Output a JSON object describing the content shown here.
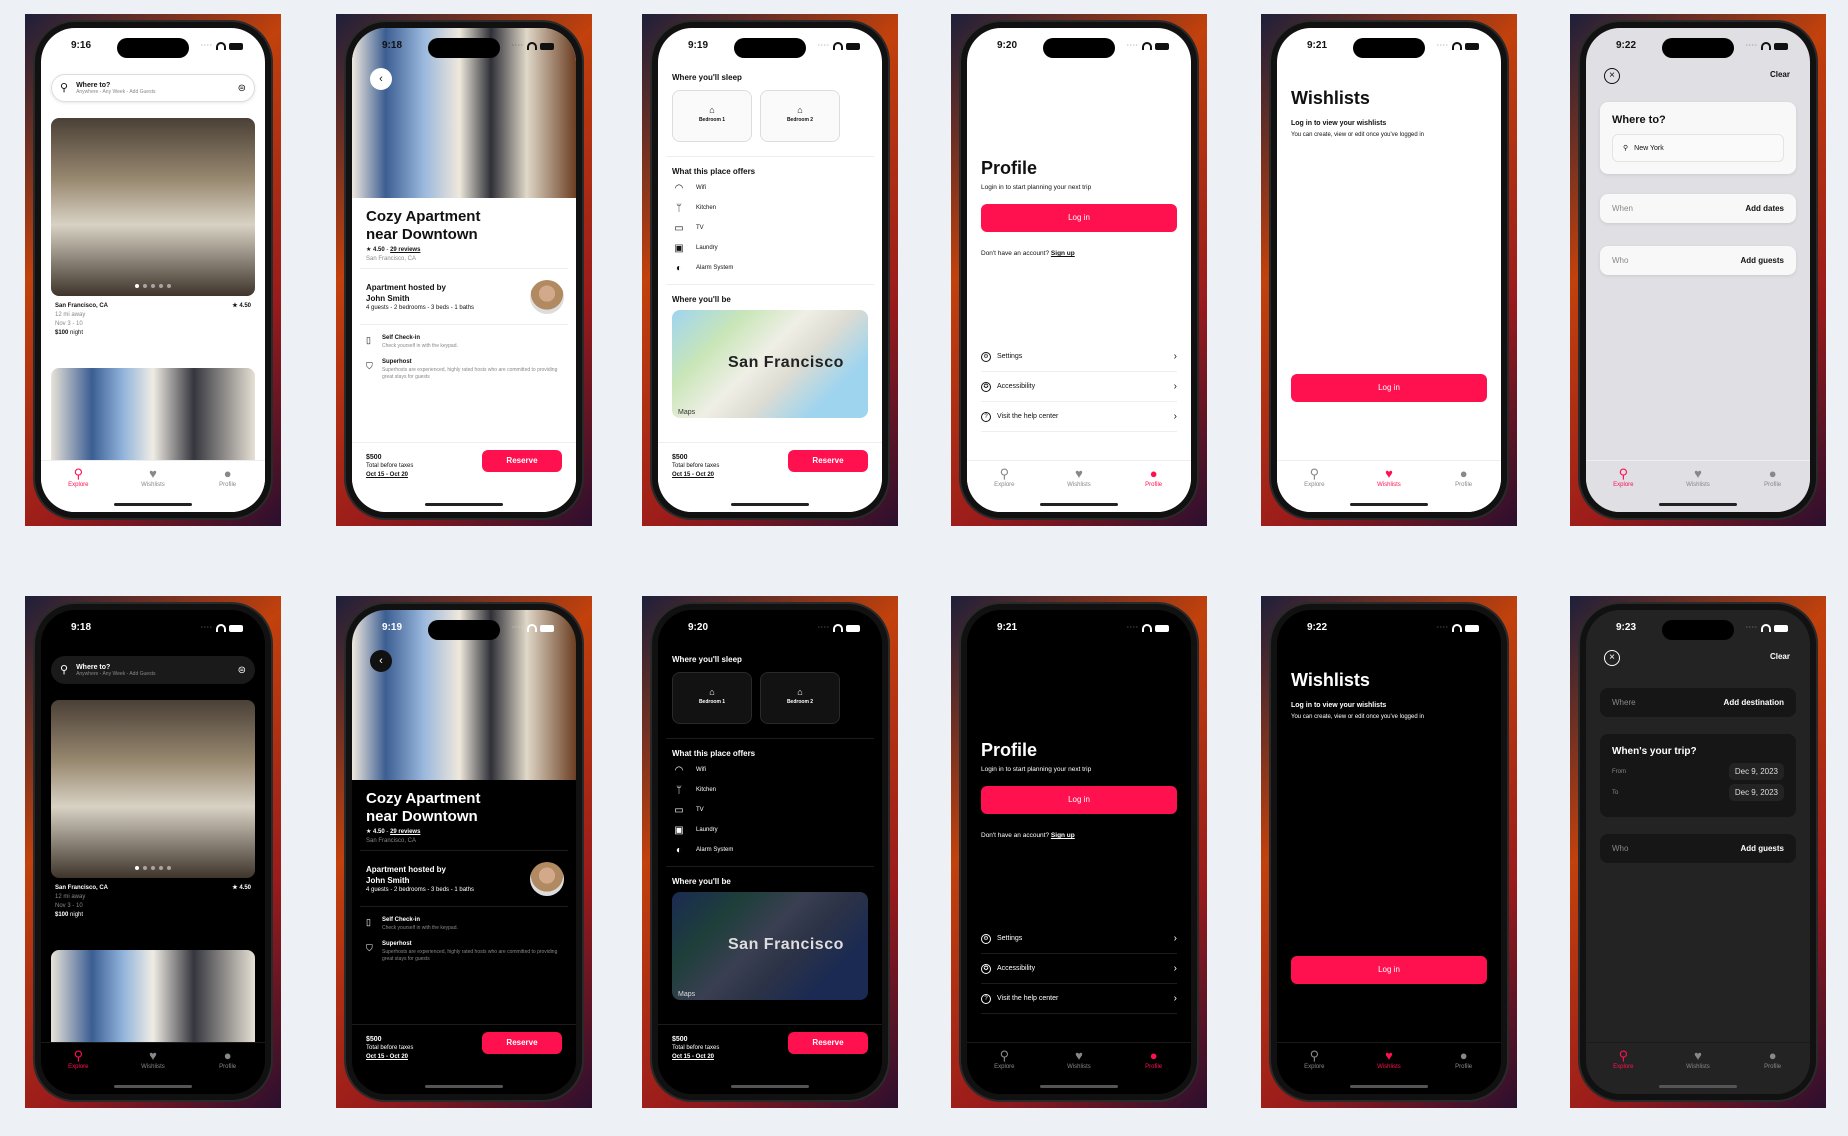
{
  "colors": {
    "accent": "#ff1150",
    "light_bg": "#ffffff",
    "dark_bg": "#000000",
    "page_bg": "#edf1f6"
  },
  "tabs": [
    "Explore",
    "Wishlists",
    "Profile"
  ],
  "tab_icons": [
    "search-icon",
    "heart-icon",
    "person-icon"
  ],
  "screens": {
    "explore_light": {
      "time": "9:16",
      "search_title": "Where to?",
      "search_subtitle": "Anywhere - Any Week - Add Guests",
      "listing": {
        "location": "San Francisco, CA",
        "rating": "4.50",
        "distance": "12 mi away",
        "dates": "Nov 3 - 10",
        "price": "$100",
        "price_unit": "night"
      },
      "active_tab": "Explore"
    },
    "detail_light": {
      "time": "9:18",
      "title_line1": "Cozy Apartment",
      "title_line2": "near Downtown",
      "rating": "4.50",
      "reviews": "29 reviews",
      "location": "San Francisco, CA",
      "host_line1": "Apartment hosted by",
      "host_line2": "John Smith",
      "host_details": "4 guests - 2 bedrooms - 3 beds - 1 baths",
      "feature1_title": "Self Check-in",
      "feature1_desc": "Check yourself in with the keypad.",
      "feature2_title": "Superhost",
      "feature2_desc": "Superhosts are experienced, highly rated hosts who are committed to providing great stays for guests",
      "price": "$500",
      "price_note": "Total before taxes",
      "dates": "Oct 15 - Oct 20",
      "reserve": "Reserve"
    },
    "detail_scrolled_light": {
      "time": "9:19",
      "sleep_title": "Where you'll sleep",
      "bedrooms": [
        "Bedroom 1",
        "Bedroom 2"
      ],
      "offers_title": "What this place offers",
      "amenities": [
        {
          "label": "Wifi",
          "icon": "wifi-icon"
        },
        {
          "label": "Kitchen",
          "icon": "fork-knife-icon"
        },
        {
          "label": "TV",
          "icon": "tv-icon"
        },
        {
          "label": "Laundry",
          "icon": "washer-icon"
        },
        {
          "label": "Alarm System",
          "icon": "shield-icon"
        }
      ],
      "map_title": "Where you'll be",
      "map_label": "San Francisco",
      "map_brand": "Maps",
      "price": "$500",
      "price_note": "Total before taxes",
      "dates": "Oct 15 - Oct 20",
      "reserve": "Reserve"
    },
    "profile_light": {
      "time": "9:20",
      "title": "Profile",
      "subtitle": "Login in to start planning your next trip",
      "login": "Log in",
      "signup_prompt": "Don't have an account?",
      "signup": "Sign up",
      "menu": [
        "Settings",
        "Accessibility",
        "Visit the help center"
      ],
      "active_tab": "Profile"
    },
    "wishlists_light": {
      "time": "9:21",
      "title": "Wishlists",
      "heading": "Log in to view your wishlists",
      "body": "You can create, view or edit once you've logged in",
      "login": "Log in",
      "active_tab": "Wishlists"
    },
    "search_light": {
      "time": "9:22",
      "clear": "Clear",
      "where_title": "Where to?",
      "where_value": "New York",
      "when_label": "When",
      "when_value": "Add dates",
      "who_label": "Who",
      "who_value": "Add guests",
      "active_tab": "Explore"
    },
    "explore_dark": {
      "time": "9:18",
      "search_title": "Where to?",
      "search_subtitle": "Anywhere - Any Week - Add Guests",
      "listing": {
        "location": "San Francisco, CA",
        "rating": "4.50",
        "distance": "12 mi away",
        "dates": "Nov 3 - 10",
        "price": "$100",
        "price_unit": "night"
      },
      "active_tab": "Explore"
    },
    "detail_dark": {
      "time": "9:19",
      "title_line1": "Cozy Apartment",
      "title_line2": "near Downtown",
      "rating": "4.50",
      "reviews": "29 reviews",
      "location": "San Francisco, CA",
      "host_line1": "Apartment hosted by",
      "host_line2": "John Smith",
      "host_details": "4 guests - 2 bedrooms - 3 beds - 1 baths",
      "feature1_title": "Self Check-in",
      "feature1_desc": "Check yourself in with the keypad.",
      "feature2_title": "Superhost",
      "feature2_desc": "Superhosts are experienced, highly rated hosts who are committed to providing great stays for guests",
      "price": "$500",
      "price_note": "Total before taxes",
      "dates": "Oct 15 - Oct 20",
      "reserve": "Reserve"
    },
    "detail_scrolled_dark": {
      "time": "9:20",
      "sleep_title": "Where you'll sleep",
      "bedrooms": [
        "Bedroom 1",
        "Bedroom 2"
      ],
      "offers_title": "What this place offers",
      "amenities": [
        {
          "label": "Wifi",
          "icon": "wifi-icon"
        },
        {
          "label": "Kitchen",
          "icon": "fork-knife-icon"
        },
        {
          "label": "TV",
          "icon": "tv-icon"
        },
        {
          "label": "Laundry",
          "icon": "washer-icon"
        },
        {
          "label": "Alarm System",
          "icon": "shield-icon"
        }
      ],
      "map_title": "Where you'll be",
      "map_label": "San Francisco",
      "map_brand": "Maps",
      "price": "$500",
      "price_note": "Total before taxes",
      "dates": "Oct 15 - Oct 20",
      "reserve": "Reserve"
    },
    "profile_dark": {
      "time": "9:21",
      "title": "Profile",
      "subtitle": "Login in to start planning your next trip",
      "login": "Log in",
      "signup_prompt": "Don't have an account?",
      "signup": "Sign up",
      "menu": [
        "Settings",
        "Accessibility",
        "Visit the help center"
      ],
      "active_tab": "Profile"
    },
    "wishlists_dark": {
      "time": "9:22",
      "title": "Wishlists",
      "heading": "Log in to view your wishlists",
      "body": "You can create, view or edit once you've logged in",
      "login": "Log in",
      "active_tab": "Wishlists"
    },
    "search_dark": {
      "time": "9:23",
      "clear": "Clear",
      "where_label": "Where",
      "where_value": "Add destination",
      "when_title": "When's your trip?",
      "from_label": "From",
      "from_value": "Dec 9, 2023",
      "to_label": "To",
      "to_value": "Dec 9, 2023",
      "who_label": "Who",
      "who_value": "Add guests",
      "active_tab": "Explore"
    }
  }
}
